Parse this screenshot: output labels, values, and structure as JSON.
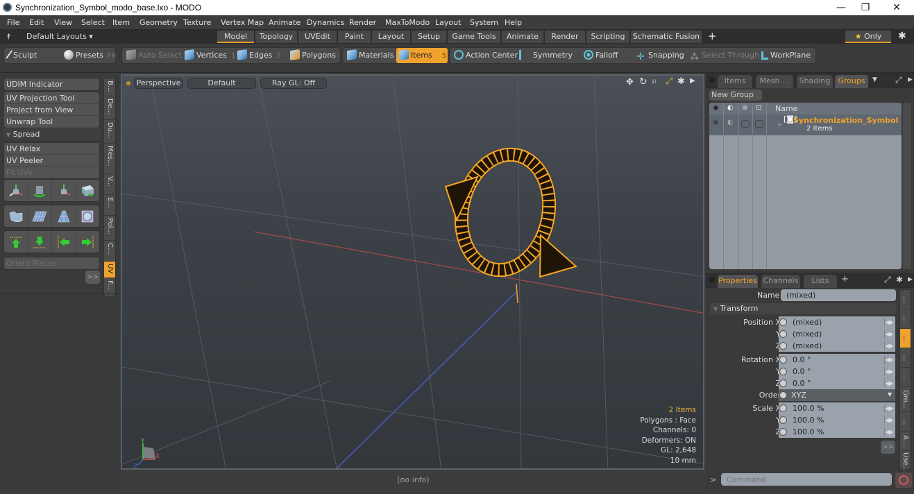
{
  "window": {
    "title": "Synchronization_Symbol_modo_base.lxo - MODO",
    "controls": {
      "minimize": "—",
      "restore": "❐",
      "close": "✕"
    }
  },
  "menu": [
    "File",
    "Edit",
    "View",
    "Select",
    "Item",
    "Geometry",
    "Texture",
    "Vertex Map",
    "Animate",
    "Dynamics",
    "Render",
    "MaxToModo",
    "Layout",
    "System",
    "Help"
  ],
  "layouts": {
    "dropdown_label": "Default Layouts ▾",
    "tabs": [
      "Model",
      "Topology",
      "UVEdit",
      "Paint",
      "Layout",
      "Setup",
      "Game Tools",
      "Animate",
      "Render",
      "Scripting",
      "Schematic Fusion"
    ],
    "active_tab": "Model",
    "add_label": "+",
    "only_label": "Only"
  },
  "toolbar": {
    "sculpt": "Sculpt",
    "presets": "Presets",
    "presets_key": "F6",
    "auto_select": "Auto Select",
    "vertices": "Vertices",
    "vertices_key": "1",
    "edges": "Edges",
    "edges_key": "2",
    "polygons": "Polygons",
    "materials": "Materials",
    "items": "Items",
    "items_key": "5",
    "action_center": "Action Center",
    "symmetry": "Symmetry",
    "falloff": "Falloff",
    "snapping": "Snapping",
    "select_through": "Select Through",
    "workplane": "WorkPlane"
  },
  "left_panel": {
    "udim": "UDIM Indicator",
    "tools": [
      "UV Projection Tool",
      "Project from View",
      "Unwrap Tool"
    ],
    "spread": "Spread",
    "relax_tools": [
      "UV Relax",
      "UV Peeler",
      "Fit UVs"
    ],
    "orient": "Orient Pieces",
    "more": ">>",
    "vtabs": [
      "B...",
      "De...",
      "Du...",
      "Mes...",
      "V...",
      "E...",
      "Pol...",
      "C...",
      "UV",
      "F..."
    ],
    "active_vtab": "UV"
  },
  "viewport": {
    "view_mode": "Perspective",
    "shading": "Default",
    "raygl": "Ray GL: Off",
    "info": {
      "items": "2 Items",
      "polygons": "Polygons : Face",
      "channels": "Channels: 0",
      "deformers": "Deformers: ON",
      "gl": "GL: 2,648",
      "scale": "10 mm"
    },
    "axis": {
      "x": "X",
      "y": "Y",
      "z": "Z"
    }
  },
  "status": "(no info)",
  "groups_panel": {
    "tabs": [
      "Items",
      "Mesh ...",
      "Shading",
      "Groups"
    ],
    "active_tab": "Groups",
    "new_group": "New Group",
    "col_name": "Name",
    "group": {
      "name": "Synchronization_Symbol",
      "count": "2 Items"
    }
  },
  "properties_panel": {
    "tabs": [
      "Properties",
      "Channels",
      "Lists"
    ],
    "active_tab": "Properties",
    "name_label": "Name",
    "name_value": "(mixed)",
    "section": "Transform",
    "rows": [
      {
        "label": "Position X",
        "value": "(mixed)"
      },
      {
        "label": "Y",
        "value": "(mixed)"
      },
      {
        "label": "Z",
        "value": "(mixed)"
      },
      {
        "label": "Rotation X",
        "value": "0.0 °"
      },
      {
        "label": "Y",
        "value": "0.0 °"
      },
      {
        "label": "Z",
        "value": "0.0 °"
      },
      {
        "label": "Order",
        "value": "XYZ"
      },
      {
        "label": "Scale X",
        "value": "100.0 %"
      },
      {
        "label": "Y",
        "value": "100.0 %"
      },
      {
        "label": "Z",
        "value": "100.0 %"
      }
    ],
    "more": ">>",
    "vtabs": [
      "...",
      "...",
      "...",
      "...",
      "...",
      "Gro...",
      "...",
      "A...",
      "Use...",
      "..."
    ],
    "active_vtab_index": 2
  },
  "command": {
    "prompt": ">",
    "placeholder": "Command"
  },
  "colors": {
    "accent": "#f0a22e",
    "wire": "#f5a623",
    "x_axis": "#b0463c",
    "z_axis": "#4a5cc0"
  }
}
